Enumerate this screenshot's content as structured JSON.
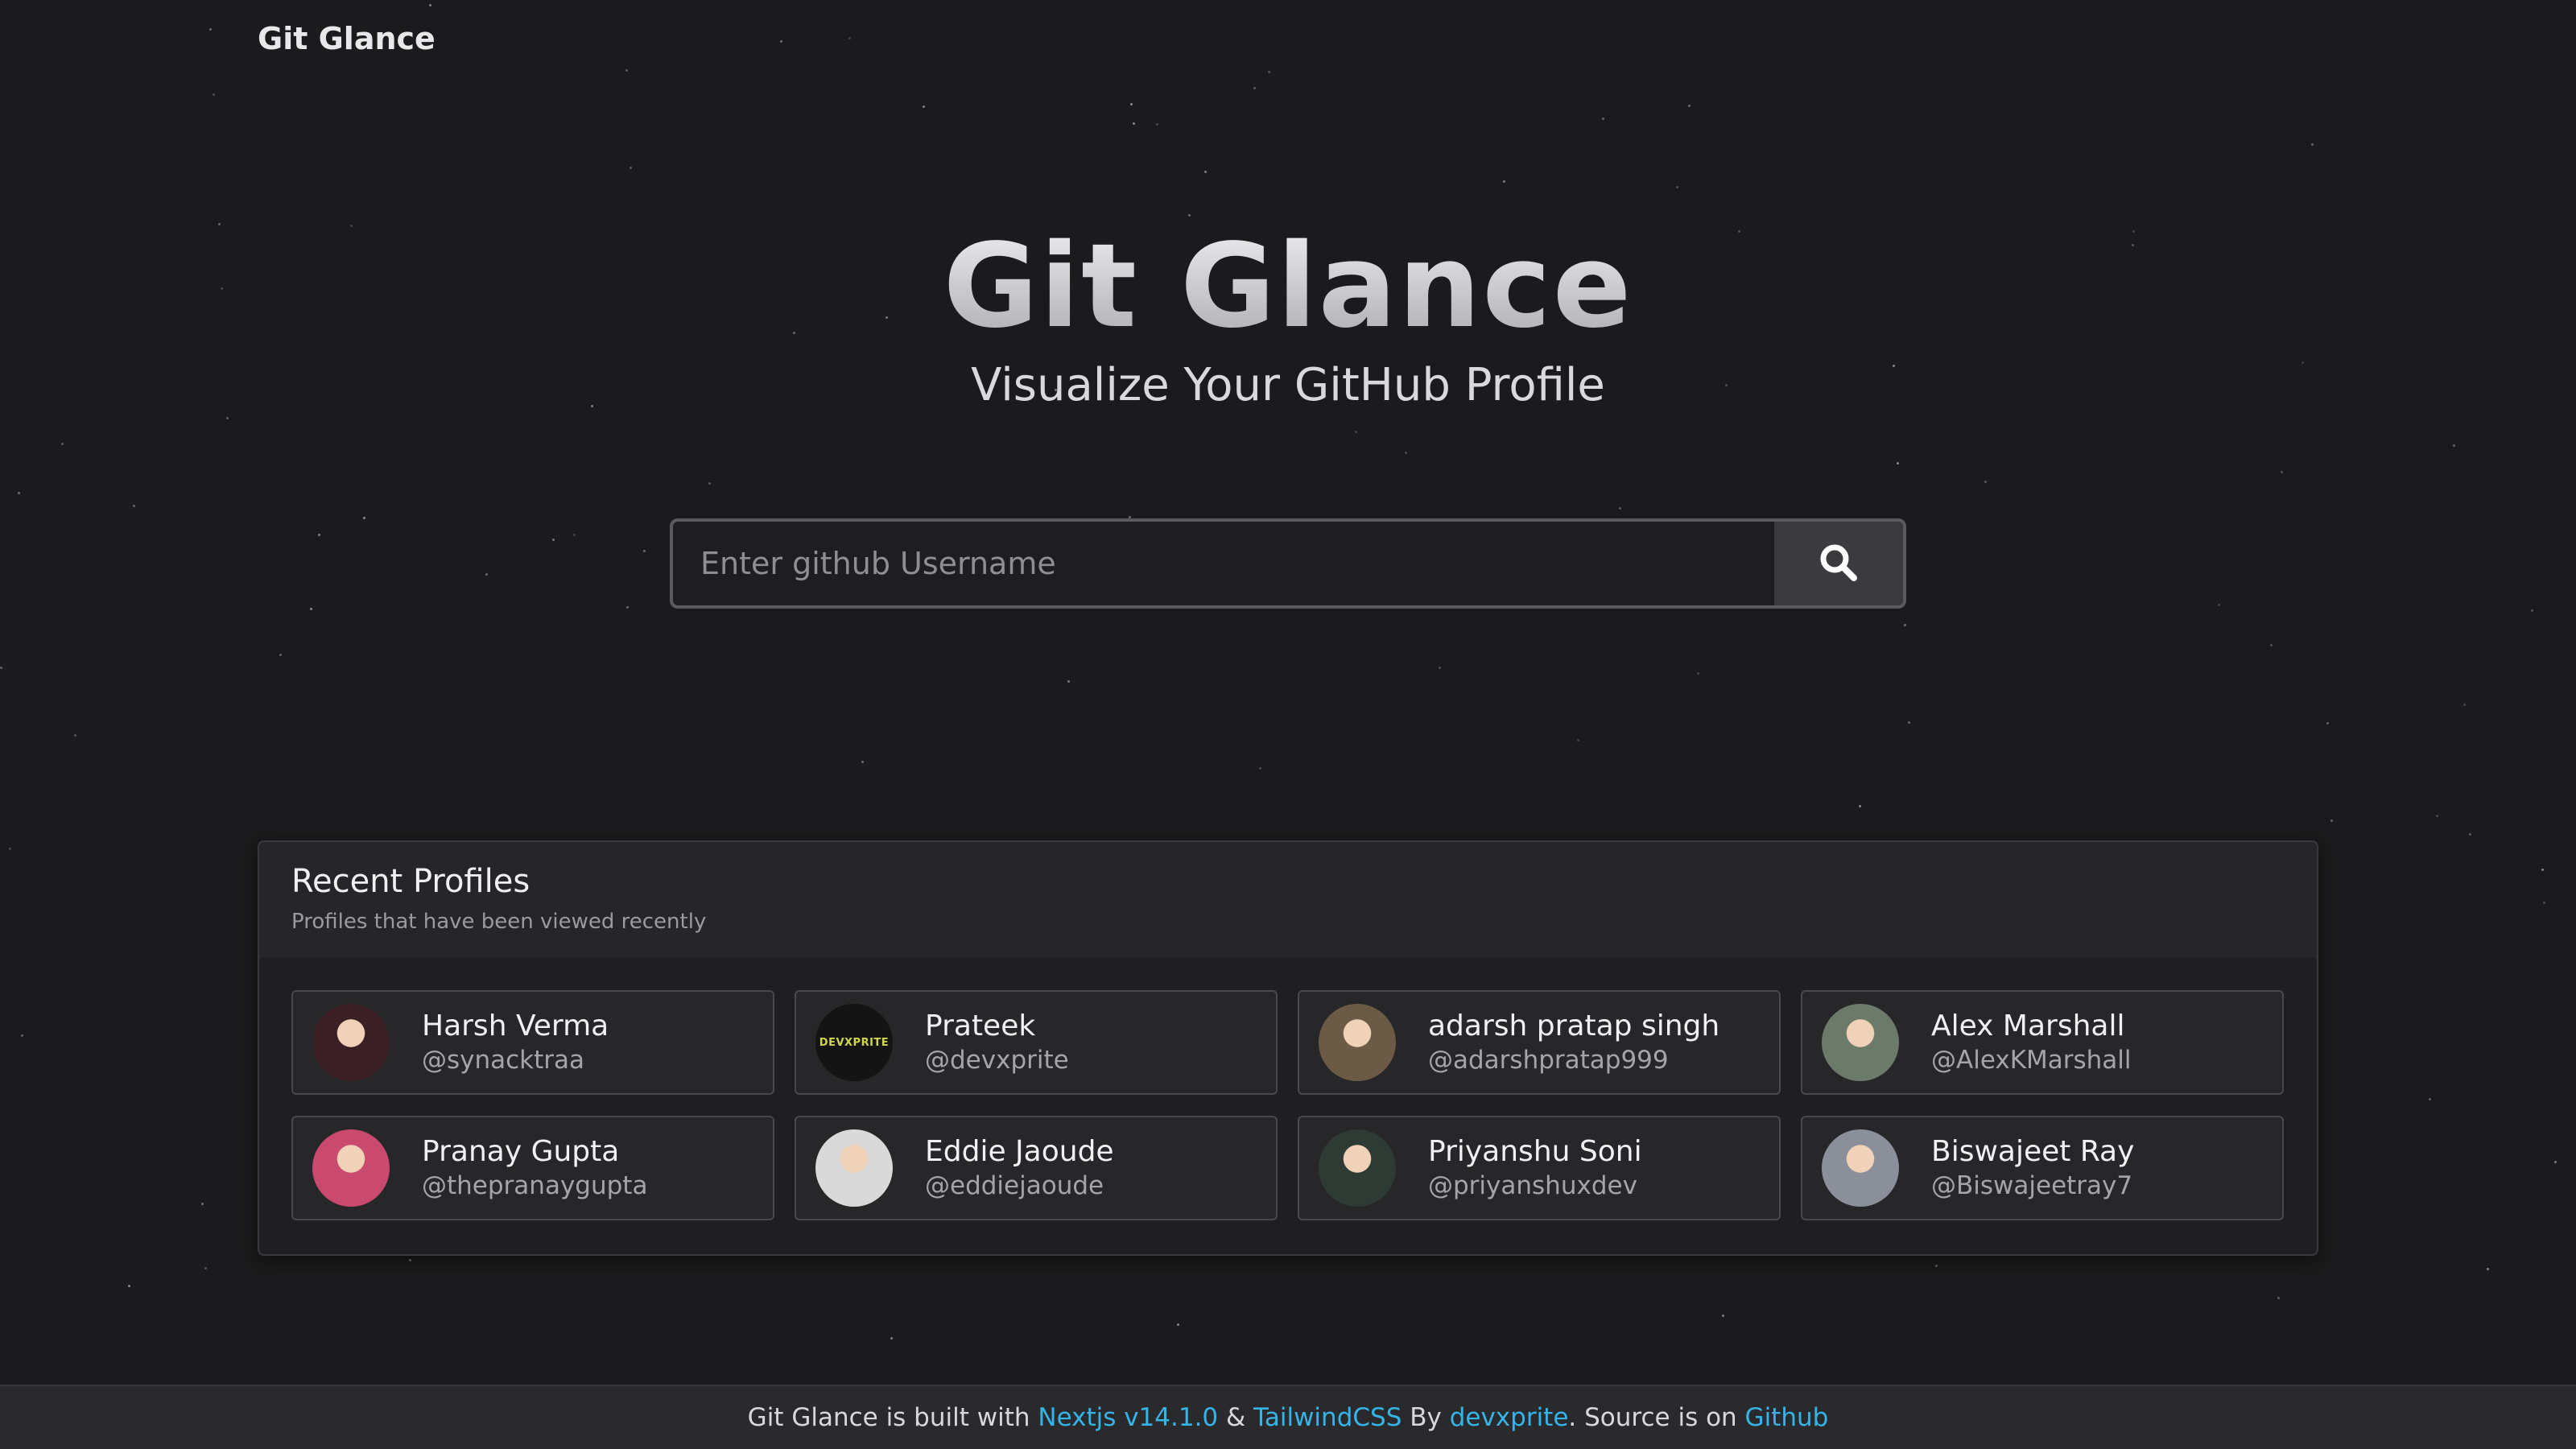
{
  "brand": "Git Glance",
  "hero": {
    "title": "Git Glance",
    "subtitle": "Visualize Your GitHub Profile"
  },
  "search": {
    "placeholder": "Enter github Username",
    "value": "",
    "button_icon": "search-icon"
  },
  "recent": {
    "title": "Recent Profiles",
    "description": "Profiles that have been viewed recently",
    "profiles": [
      {
        "name": "Harsh Verma",
        "handle": "@synacktraa",
        "avatar_color": "#3a1f24"
      },
      {
        "name": "Prateek",
        "handle": "@devxprite",
        "avatar_color": "#141414",
        "avatar_text": "DEVXPRITE"
      },
      {
        "name": "adarsh pratap singh",
        "handle": "@adarshpratap999",
        "avatar_color": "#6b5a45"
      },
      {
        "name": "Alex Marshall",
        "handle": "@AlexKMarshall",
        "avatar_color": "#6c7a6a"
      },
      {
        "name": "Pranay Gupta",
        "handle": "@thepranaygupta",
        "avatar_color": "#c94a6e"
      },
      {
        "name": "Eddie Jaoude",
        "handle": "@eddiejaoude",
        "avatar_color": "#d9d9d9"
      },
      {
        "name": "Priyanshu Soni",
        "handle": "@priyanshuxdev",
        "avatar_color": "#2e3a34"
      },
      {
        "name": "Biswajeet Ray",
        "handle": "@Biswajeetray7",
        "avatar_color": "#8a8f99"
      }
    ]
  },
  "footer": {
    "text_1": "Git Glance is built with ",
    "link_nextjs": "Nextjs v14.1.0",
    "text_2": " & ",
    "link_tailwind": "TailwindCSS",
    "text_3": " By ",
    "link_author": "devxprite",
    "text_4": ". Source is on ",
    "link_source": "Github",
    "link_color": "#35b4e8"
  }
}
